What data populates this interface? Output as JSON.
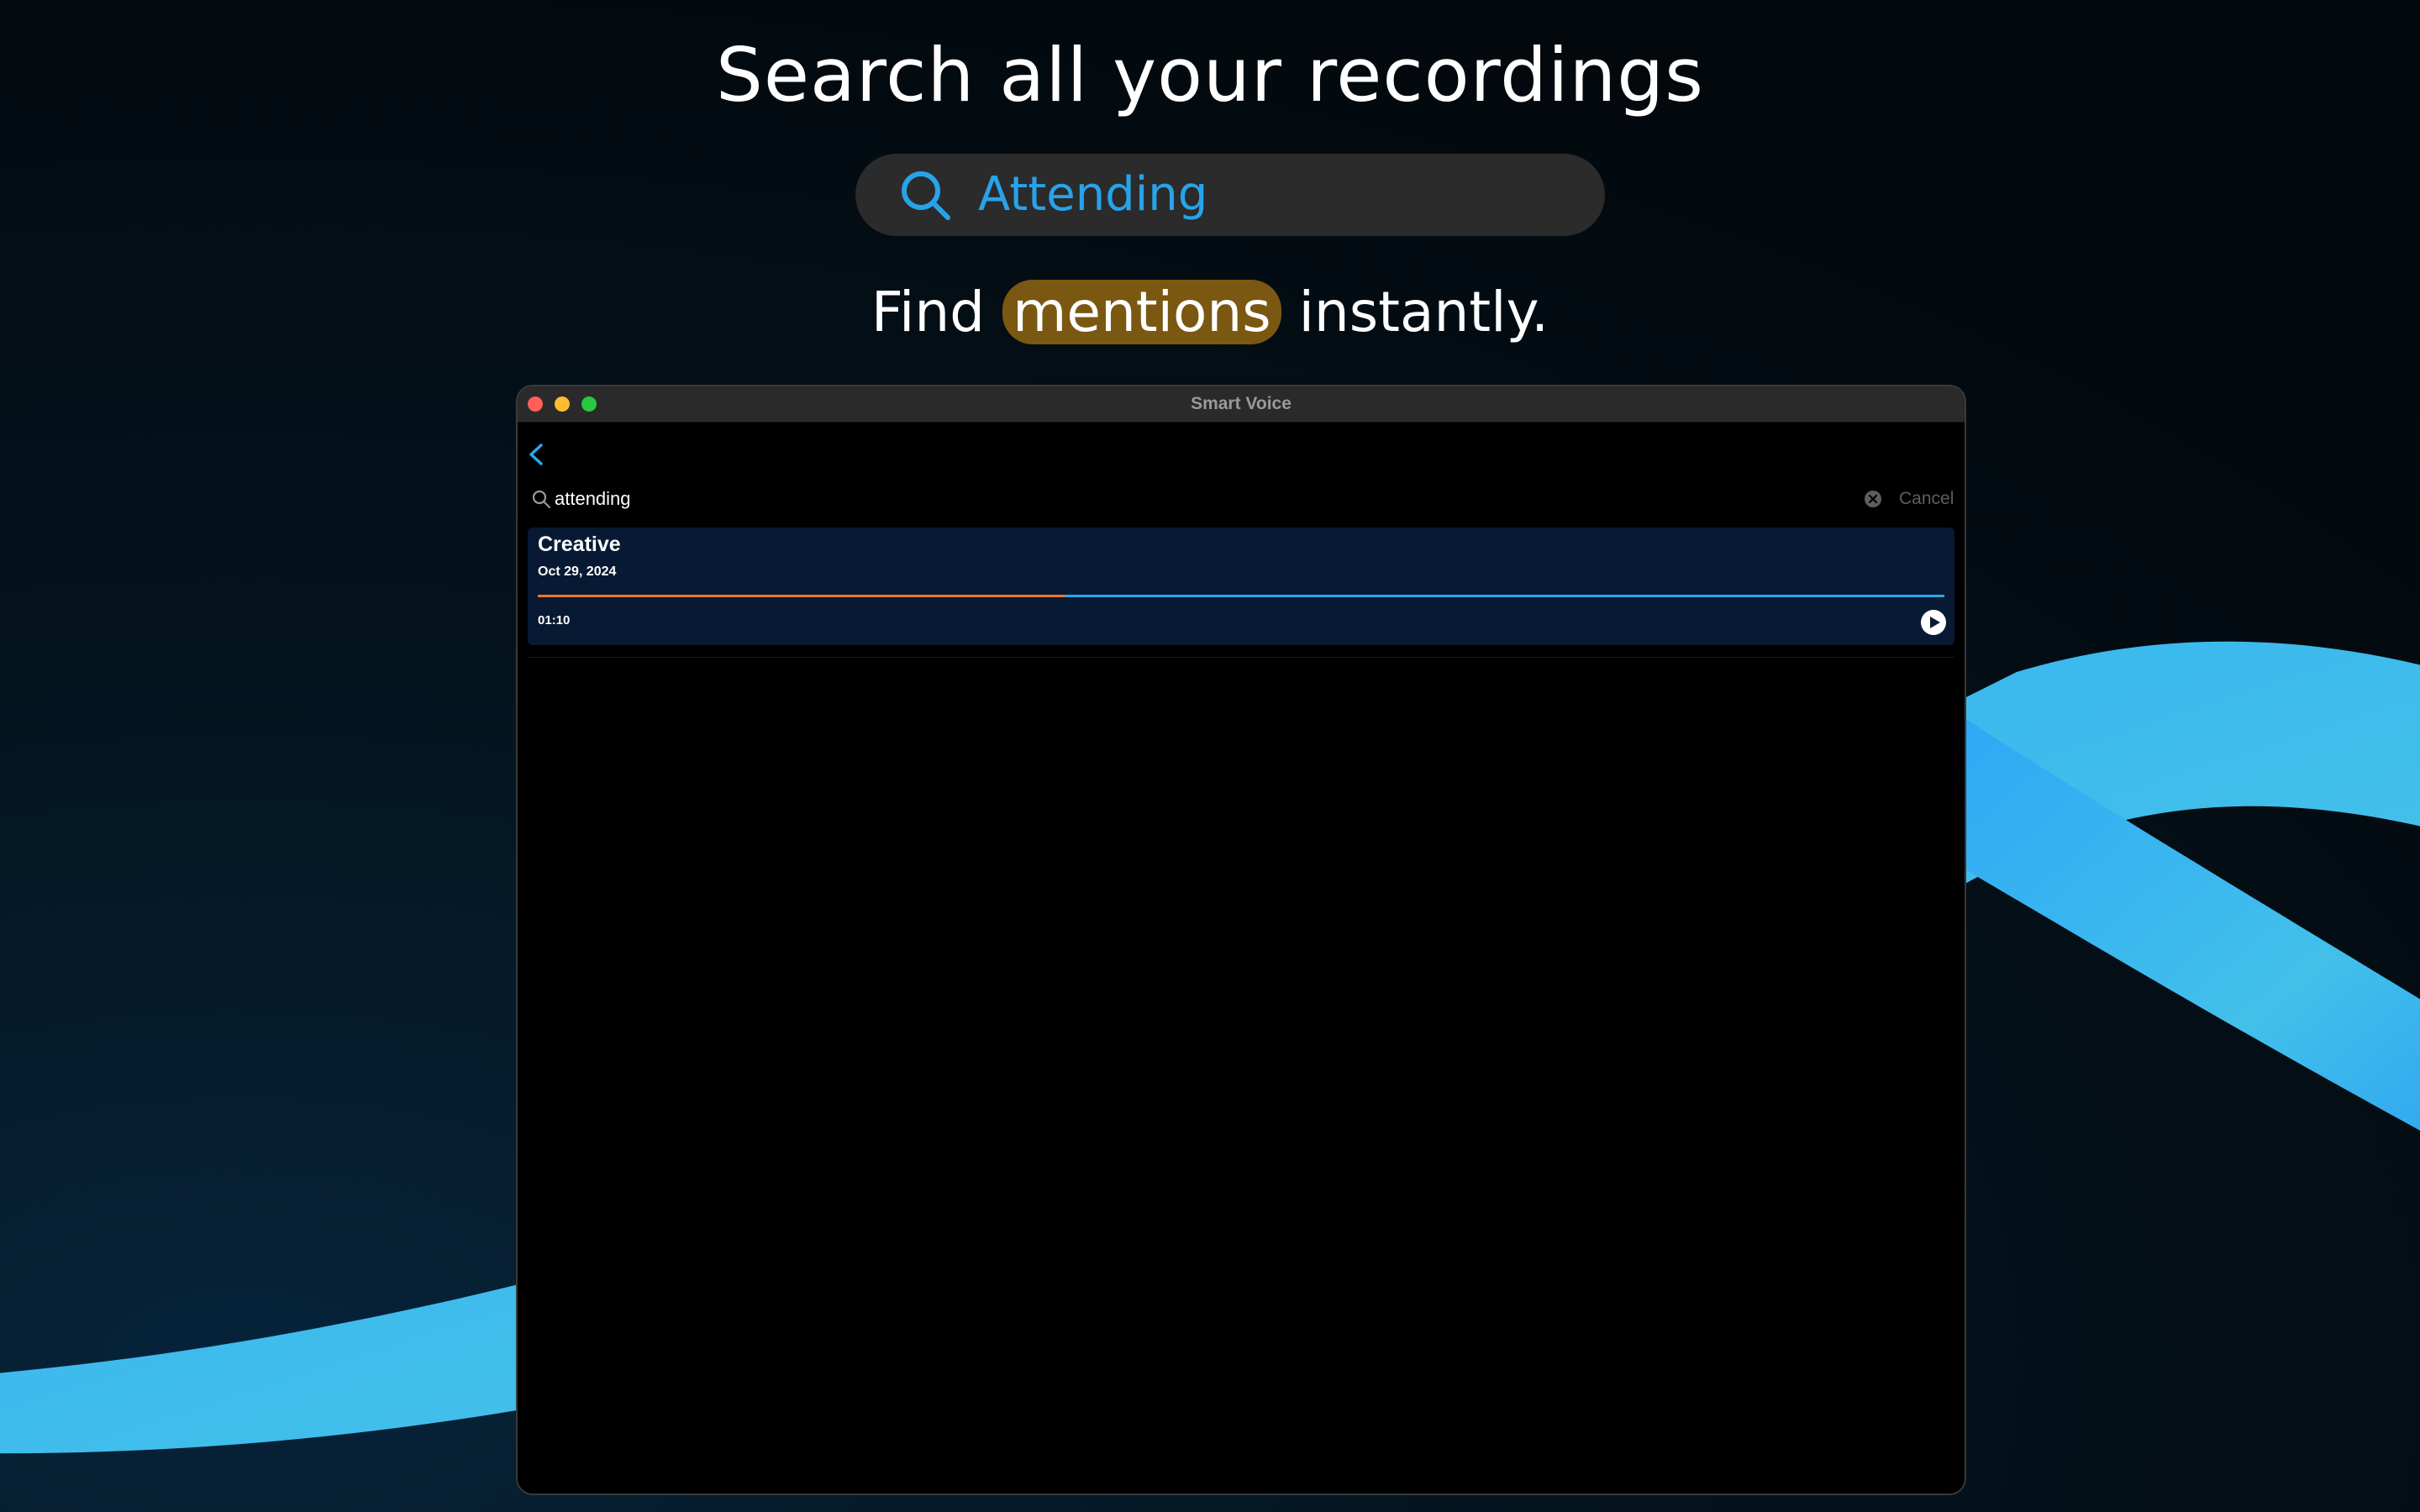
{
  "promo": {
    "headline": "Search all your recordings",
    "search_query": "Attending",
    "tagline_before": "Find",
    "tagline_highlight": "mentions",
    "tagline_after": "instantly."
  },
  "window": {
    "title": "Smart Voice",
    "search": {
      "value": "attending",
      "cancel_label": "Cancel"
    },
    "results": [
      {
        "title": "Creative",
        "date": "Oct 29, 2024",
        "duration": "01:10",
        "progress": 0.375
      }
    ]
  },
  "colors": {
    "accent_blue": "#27a3ea",
    "highlight": "#7a5812",
    "progress_played": "#f0772c",
    "progress_track": "#2aa6e6",
    "card_bg": "#081a33"
  },
  "icons": {
    "promo_search": "search-icon",
    "back": "chevron-left-icon",
    "search": "magnifier-icon",
    "clear": "clear-icon",
    "play": "play-icon"
  }
}
